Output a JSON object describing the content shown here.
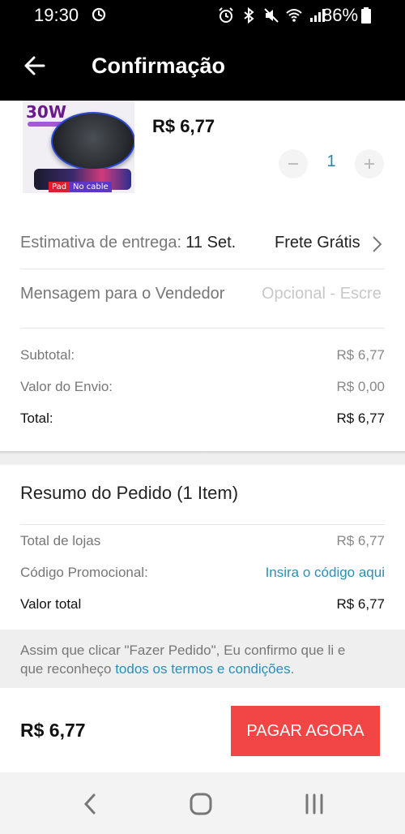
{
  "status_bar": {
    "time": "19:30",
    "battery": "86%"
  },
  "header": {
    "title": "Confirmação"
  },
  "product": {
    "image_badge": "30W",
    "image_tag_pad": "Pad",
    "image_tag_cable": "No cable",
    "price": "R$ 6,77",
    "quantity": "1"
  },
  "delivery": {
    "estimate_label": "Estimativa de entrega:",
    "estimate_date": "11 Set.",
    "shipping": "Frete Grátis"
  },
  "message": {
    "label": "Mensagem para o Vendedor",
    "placeholder": "Opcional - Escre"
  },
  "costs": {
    "subtotal_label": "Subtotal:",
    "subtotal_value": "R$ 6,77",
    "shipping_label": "Valor do Envio:",
    "shipping_value": "R$ 0,00",
    "total_label": "Total:",
    "total_value": "R$ 6,77"
  },
  "summary": {
    "title": "Resumo do Pedido (1 Item)",
    "stores_label": "Total de lojas",
    "stores_value": "R$ 6,77",
    "promo_label": "Código Promocional:",
    "promo_link": "Insira o código aqui",
    "total_label": "Valor total",
    "total_value": "R$ 6,77"
  },
  "terms": {
    "line1": "Assim que clicar \"Fazer Pedido\", Eu confirmo que li e",
    "line2_prefix": "que reconheço ",
    "line2_link": "todos os termos e condições",
    "line2_suffix": "."
  },
  "footer": {
    "total": "R$ 6,77",
    "pay_button": "PAGAR AGORA"
  },
  "colors": {
    "accent_blue": "#2a8fb8",
    "pay_red": "#f24646",
    "header_bg": "#000000"
  }
}
